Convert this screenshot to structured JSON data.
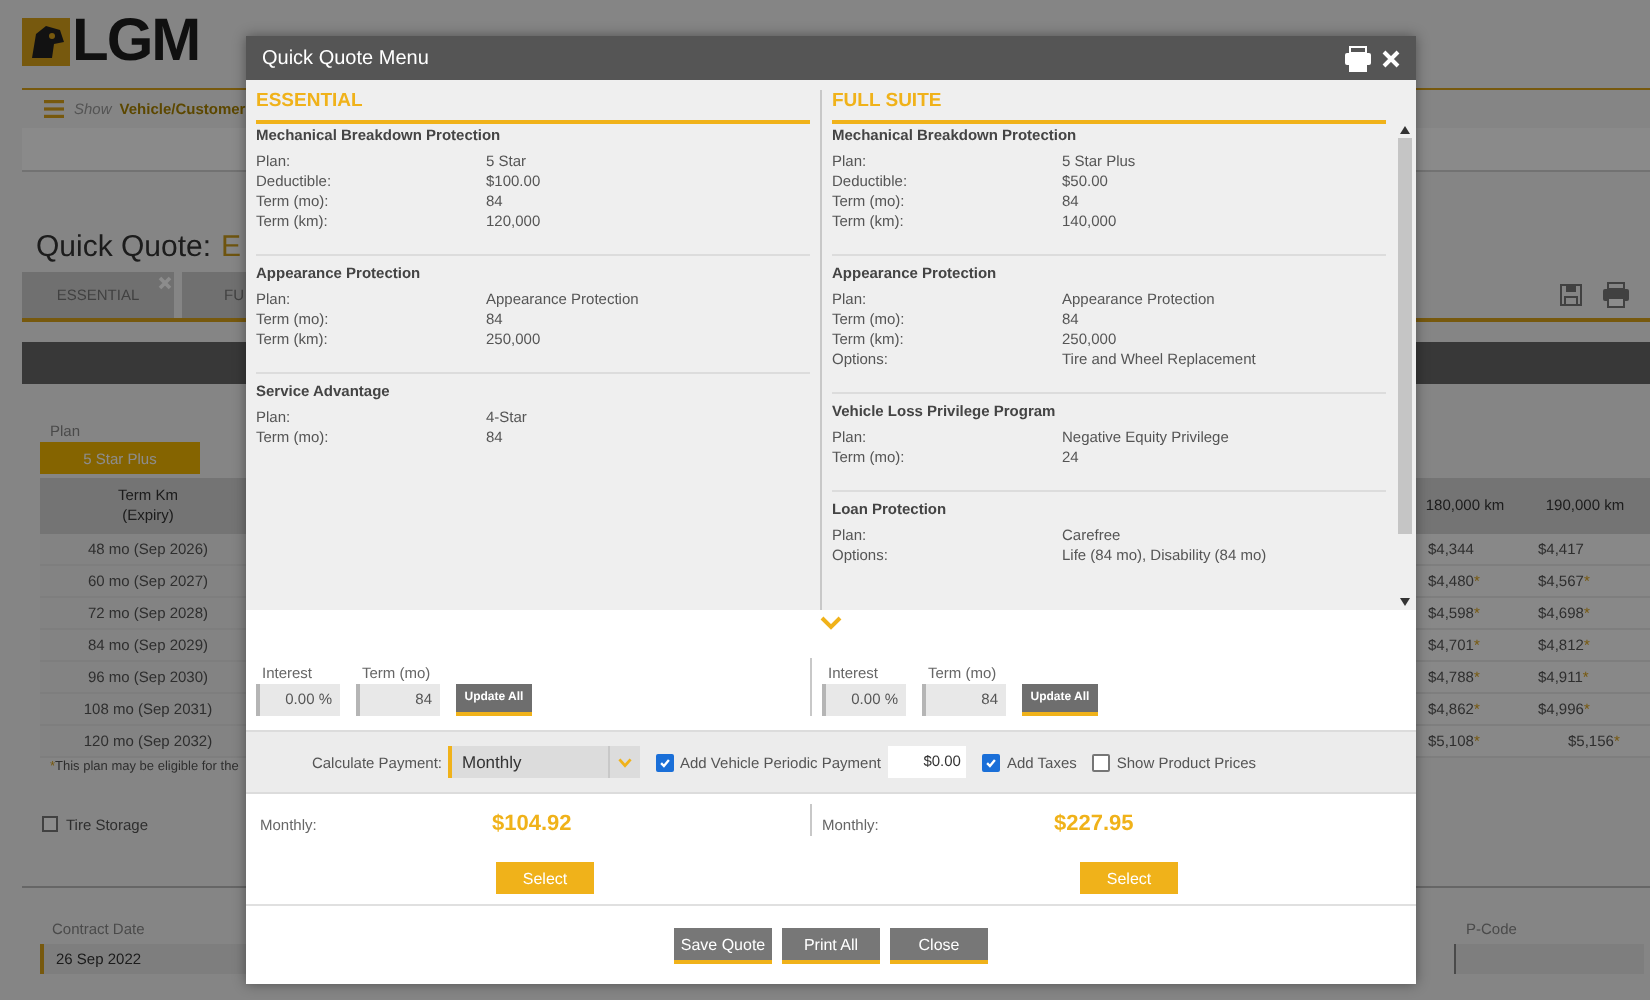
{
  "background": {
    "logo": "LGM",
    "nav": {
      "label": "Show",
      "link": "Vehicle/Customer"
    },
    "page_title": {
      "label": "Quick Quote:",
      "value": "E"
    },
    "tabs": [
      {
        "label": "ESSENTIAL",
        "selected": false,
        "closable": true
      },
      {
        "label": "FU",
        "selected": false
      }
    ],
    "plan": {
      "label": "Plan",
      "options": [
        {
          "label": "5 Star Plus",
          "selected": true
        }
      ]
    },
    "table": {
      "columns": [
        "Term Km\n(Expiry)",
        "180,000 km",
        "190,000 km"
      ],
      "rows": [
        {
          "term": "48 mo (Sep 2026)",
          "prices": [
            {
              "amount": "$4,344"
            },
            {
              "amount": "$4,417"
            }
          ]
        },
        {
          "term": "60 mo (Sep 2027)",
          "prices": [
            {
              "amount": "$4,480",
              "flag": "*"
            },
            {
              "amount": "$4,567",
              "flag": "*"
            }
          ]
        },
        {
          "term": "72 mo (Sep 2028)",
          "prices": [
            {
              "amount": "$4,598",
              "flag": "*"
            },
            {
              "amount": "$4,698",
              "flag": "*"
            }
          ]
        },
        {
          "term": "84 mo (Sep 2029)",
          "prices": [
            {
              "amount": "$4,701",
              "flag": "*"
            },
            {
              "amount": "$4,812",
              "flag": "*"
            }
          ]
        },
        {
          "term": "96 mo (Sep 2030)",
          "prices": [
            {
              "amount": "$4,788",
              "flag": "*"
            },
            {
              "amount": "$4,911",
              "flag": "*"
            }
          ]
        },
        {
          "term": "108 mo (Sep 2031)",
          "prices": [
            {
              "amount": "$4,862",
              "flag": "*"
            },
            {
              "amount": "$4,996",
              "flag": "*"
            }
          ]
        },
        {
          "term": "120 mo (Sep 2032)",
          "prices": [
            {
              "amount": "$5,108",
              "flag": "*"
            },
            {
              "amount": "$5,156",
              "flag": "*"
            }
          ]
        }
      ]
    },
    "note": {
      "mark": "*",
      "text": "This plan may be eligible for the"
    },
    "tire_storage": {
      "label": "Tire Storage",
      "checked": false
    },
    "contract_date": {
      "label": "Contract Date",
      "value": "26 Sep 2022"
    },
    "p_code": {
      "label": "P-Code"
    }
  },
  "dialog": {
    "title": "Quick Quote Menu",
    "columns": [
      {
        "heading": "ESSENTIAL",
        "sections": [
          {
            "title": "Mechanical Breakdown Protection",
            "rows": [
              {
                "label": "Plan:",
                "value": "5 Star"
              },
              {
                "label": "Deductible:",
                "value": "$100.00"
              },
              {
                "label": "Term (mo):",
                "value": "84"
              },
              {
                "label": "Term (km):",
                "value": "120,000"
              }
            ]
          },
          {
            "title": "Appearance Protection",
            "rows": [
              {
                "label": "Plan:",
                "value": "Appearance Protection"
              },
              {
                "label": "Term (mo):",
                "value": "84"
              },
              {
                "label": "Term (km):",
                "value": "250,000"
              }
            ]
          },
          {
            "title": "Service Advantage",
            "rows": [
              {
                "label": "Plan:",
                "value": "4-Star"
              },
              {
                "label": "Term (mo):",
                "value": "84"
              }
            ]
          }
        ],
        "interest": {
          "label": "Interest",
          "value": "0.00 %"
        },
        "term": {
          "label": "Term (mo)",
          "value": "84"
        },
        "update_button": "Update All",
        "monthly": {
          "label": "Monthly:",
          "amount": "$104.92"
        },
        "select_button": "Select"
      },
      {
        "heading": "FULL SUITE",
        "sections": [
          {
            "title": "Mechanical Breakdown Protection",
            "rows": [
              {
                "label": "Plan:",
                "value": "5 Star Plus"
              },
              {
                "label": "Deductible:",
                "value": "$50.00"
              },
              {
                "label": "Term (mo):",
                "value": "84"
              },
              {
                "label": "Term (km):",
                "value": "140,000"
              }
            ]
          },
          {
            "title": "Appearance Protection",
            "rows": [
              {
                "label": "Plan:",
                "value": "Appearance Protection"
              },
              {
                "label": "Term (mo):",
                "value": "84"
              },
              {
                "label": "Term (km):",
                "value": "250,000"
              },
              {
                "label": "Options:",
                "value": "Tire and Wheel Replacement"
              }
            ]
          },
          {
            "title": "Vehicle Loss Privilege Program",
            "rows": [
              {
                "label": "Plan:",
                "value": "Negative Equity Privilege"
              },
              {
                "label": "Term (mo):",
                "value": "24"
              }
            ]
          },
          {
            "title": "Loan Protection",
            "rows": [
              {
                "label": "Plan:",
                "value": "Carefree"
              },
              {
                "label": "Options:",
                "value": "Life (84 mo), Disability (84 mo)"
              }
            ]
          }
        ],
        "interest": {
          "label": "Interest",
          "value": "0.00 %"
        },
        "term": {
          "label": "Term (mo)",
          "value": "84"
        },
        "update_button": "Update All",
        "monthly": {
          "label": "Monthly:",
          "amount": "$227.95"
        },
        "select_button": "Select"
      }
    ],
    "payment_bar": {
      "label": "Calculate Payment:",
      "frequency": "Monthly",
      "periodic": {
        "label": "Add Vehicle Periodic Payment",
        "checked": true,
        "amount": "$0.00"
      },
      "taxes": {
        "label": "Add Taxes",
        "checked": true
      },
      "show_prices": {
        "label": "Show Product Prices",
        "checked": false
      }
    },
    "footer_buttons": [
      "Save Quote",
      "Print All",
      "Close"
    ]
  }
}
